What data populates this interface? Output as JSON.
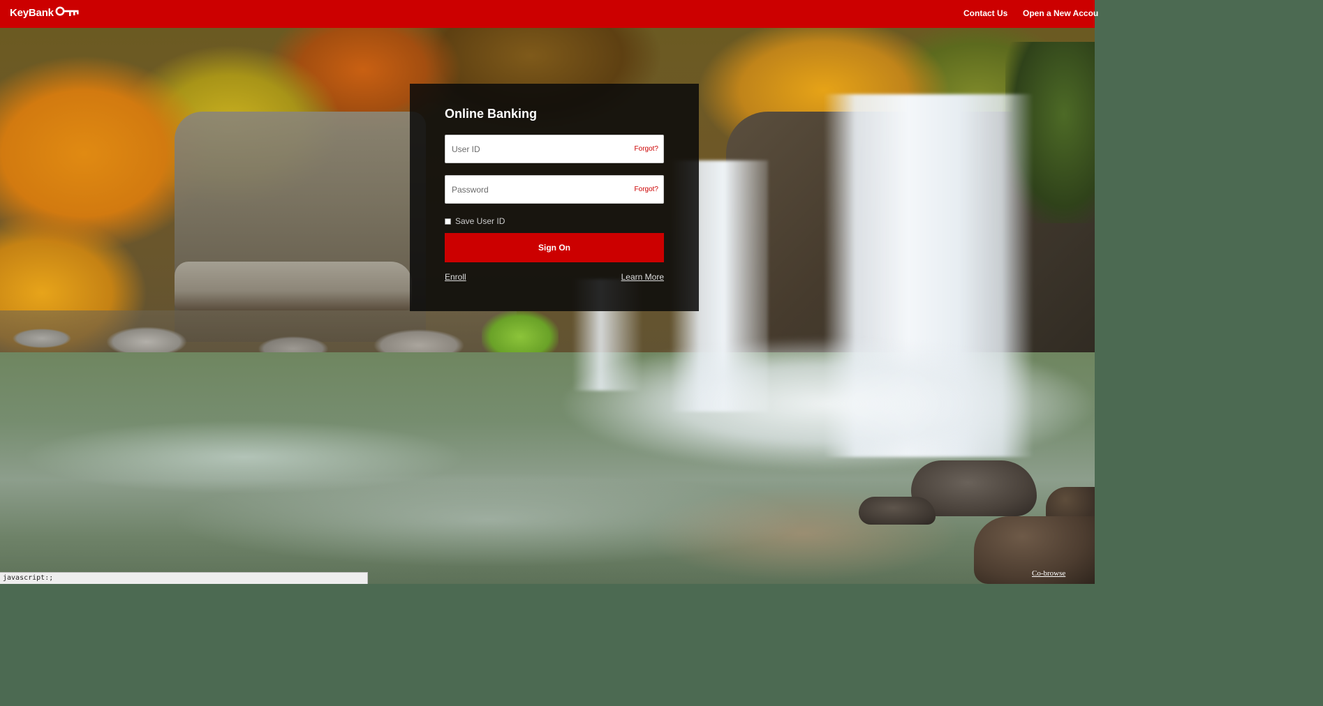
{
  "header": {
    "brand": "KeyBank",
    "logo_icon": "key-icon",
    "accent_color": "#cc0000",
    "nav": {
      "contact_us": "Contact Us",
      "open_account": "Open a New Accou"
    }
  },
  "login": {
    "title": "Online Banking",
    "user_id_placeholder": "User ID",
    "password_placeholder": "Password",
    "forgot_label": "Forgot?",
    "save_user_id_label": "Save User ID",
    "sign_on_label": "Sign On",
    "enroll_label": "Enroll",
    "learn_more_label": "Learn More"
  },
  "statusbar": {
    "text": "javascript:;"
  },
  "cobrowse": {
    "label": "Co-browse"
  }
}
